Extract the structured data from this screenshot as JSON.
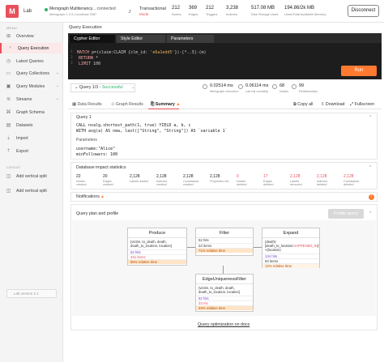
{
  "app": {
    "logo_letter": "M",
    "name": "Lab"
  },
  "connection": {
    "name": "Memgraph Multitenancy...",
    "status": "connected",
    "sub": "Memgraph 1.3.3 | localhost:7687"
  },
  "mode": {
    "label": "Transactional",
    "sub": "Mode"
  },
  "stats": [
    {
      "value": "212",
      "label": "Nodes"
    },
    {
      "value": "369",
      "label": "Edges"
    },
    {
      "value": "212",
      "label": "Triggers"
    },
    {
      "value": "3,238",
      "label": "Indexes"
    },
    {
      "value": "517.08 MB",
      "label": "Disk Storage Used"
    },
    {
      "value": "194.86/2k MB",
      "label": "Used/Total Available Memory"
    }
  ],
  "disconnect_label": "Disconnect",
  "sidebar": {
    "menu_title": "MENU",
    "items": [
      {
        "label": "Overview",
        "icon": "grid-icon",
        "chev": ""
      },
      {
        "label": "Query Execution",
        "icon": "code-icon",
        "chev": ""
      },
      {
        "label": "Latest Queries",
        "icon": "clock-icon",
        "chev": ""
      },
      {
        "label": "Query Collections",
        "icon": "folder-icon",
        "chev": "⌄"
      },
      {
        "label": "Query Modules",
        "icon": "module-icon",
        "chev": "⌄"
      },
      {
        "label": "Streams",
        "icon": "stream-icon",
        "chev": "⌄"
      },
      {
        "label": "Graph Schema",
        "icon": "schema-icon",
        "chev": ""
      },
      {
        "label": "Datasets",
        "icon": "database-icon",
        "chev": ""
      },
      {
        "label": "Import",
        "icon": "import-icon",
        "chev": ""
      },
      {
        "label": "Export",
        "icon": "export-icon",
        "chev": ""
      }
    ],
    "layout_title": "LAYOUT",
    "layout_items": [
      {
        "label": "Add vertical split",
        "icon": "split-icon"
      },
      {
        "label": "Add vertical split",
        "icon": "split-icon"
      }
    ],
    "version": "Lab version 2.1"
  },
  "breadcrumb": "Query Execution",
  "editor": {
    "tabs": [
      "Cypher Editor",
      "Style Editor",
      "Parameters"
    ],
    "gutter": [
      "1",
      "2",
      "3"
    ],
    "lines": [
      {
        "kw": "MATCH",
        "text": " p=(claim:CLAIM {clm_id: ",
        "str": "'e6a1edd5'",
        "tail": "})-[*..3]-(m)"
      },
      {
        "kw": "RETURN",
        "text": " *",
        "str": "",
        "tail": ""
      },
      {
        "kw": "LIMIT",
        "text": " 100",
        "str": "",
        "tail": ""
      }
    ],
    "run_label": "Run"
  },
  "query_status": {
    "label": "Query 1/3 - ",
    "ok": "Successful",
    "metrics": [
      {
        "value": "0.02514 ms",
        "label": "Memgraph execution"
      },
      {
        "value": "0.06114 ms",
        "label": "Lab full roundtrip"
      },
      {
        "value": "68",
        "label": "Nodes"
      },
      {
        "value": "99",
        "label": "Relationships"
      }
    ]
  },
  "result_tabs": {
    "tabs": [
      "Data Results",
      "Graph Results",
      "Summary"
    ],
    "actions": [
      "Copy all",
      "Download",
      "Fullscreen"
    ]
  },
  "summary": {
    "query_title": "Query 1",
    "query_lines": [
      "CALL nxalg.shortest_path(1, true) YIELD a, b, c",
      "WITH avg(a) AS new, last([\"String\", \"String\"]) AS `variable 1`"
    ],
    "params_title": "Parameters",
    "params_lines": [
      "username:\"Alice\"",
      "minFollowers: 100"
    ],
    "impact_title": "Database impact statistics",
    "impact": [
      {
        "value": "22",
        "label": "Nodes created"
      },
      {
        "value": "20",
        "label": "Edges created"
      },
      {
        "value": "2,128",
        "label": "Labels added"
      },
      {
        "value": "2,128",
        "label": "Indexes created"
      },
      {
        "value": "2,128",
        "label": "Constraints created"
      },
      {
        "value": "2,128",
        "label": "Properties set"
      },
      {
        "value": "0",
        "label": "Nodes deleted"
      },
      {
        "value": "17",
        "label": "Edges deleted"
      },
      {
        "value": "2,128",
        "label": "Labels removed"
      },
      {
        "value": "2,128",
        "label": "Indexes deleted"
      },
      {
        "value": "2,128",
        "label": "Constraints deleted"
      }
    ],
    "notifications_title": "Notifications",
    "notifications_count": "!",
    "plan_title": "Query plan and profile",
    "profile_btn": "Profile query",
    "doc_link": "Query optimization on docs"
  },
  "plan": {
    "produce": {
      "title": "Produce",
      "body": "{victim, to_death, death, death_to_location, location}",
      "hits": "52 hits",
      "items": "341 items",
      "rel": "55% relative time"
    },
    "filter": {
      "title": "Filter",
      "body": "52 hits",
      "items": "23 items",
      "rel": "71% relative time"
    },
    "expand": {
      "title": "Expand",
      "body_pre": "(death)-[death_to_location:",
      "body_hl": "HAPPENED_IN",
      "body_post": "]->(location)",
      "hits": "134 hits",
      "items": "83 items",
      "rel": "12% relative time"
    },
    "unique": {
      "title": "EdgeUniquenessFilter",
      "body": "{victim, to_death, death, death_to_location, location}",
      "hits": "52 hits",
      "items": "33 ms",
      "rel": "33% relative time"
    }
  },
  "colors": {
    "accent": "#e8505b",
    "run": "#ff7a30",
    "success": "#2fb36a"
  }
}
